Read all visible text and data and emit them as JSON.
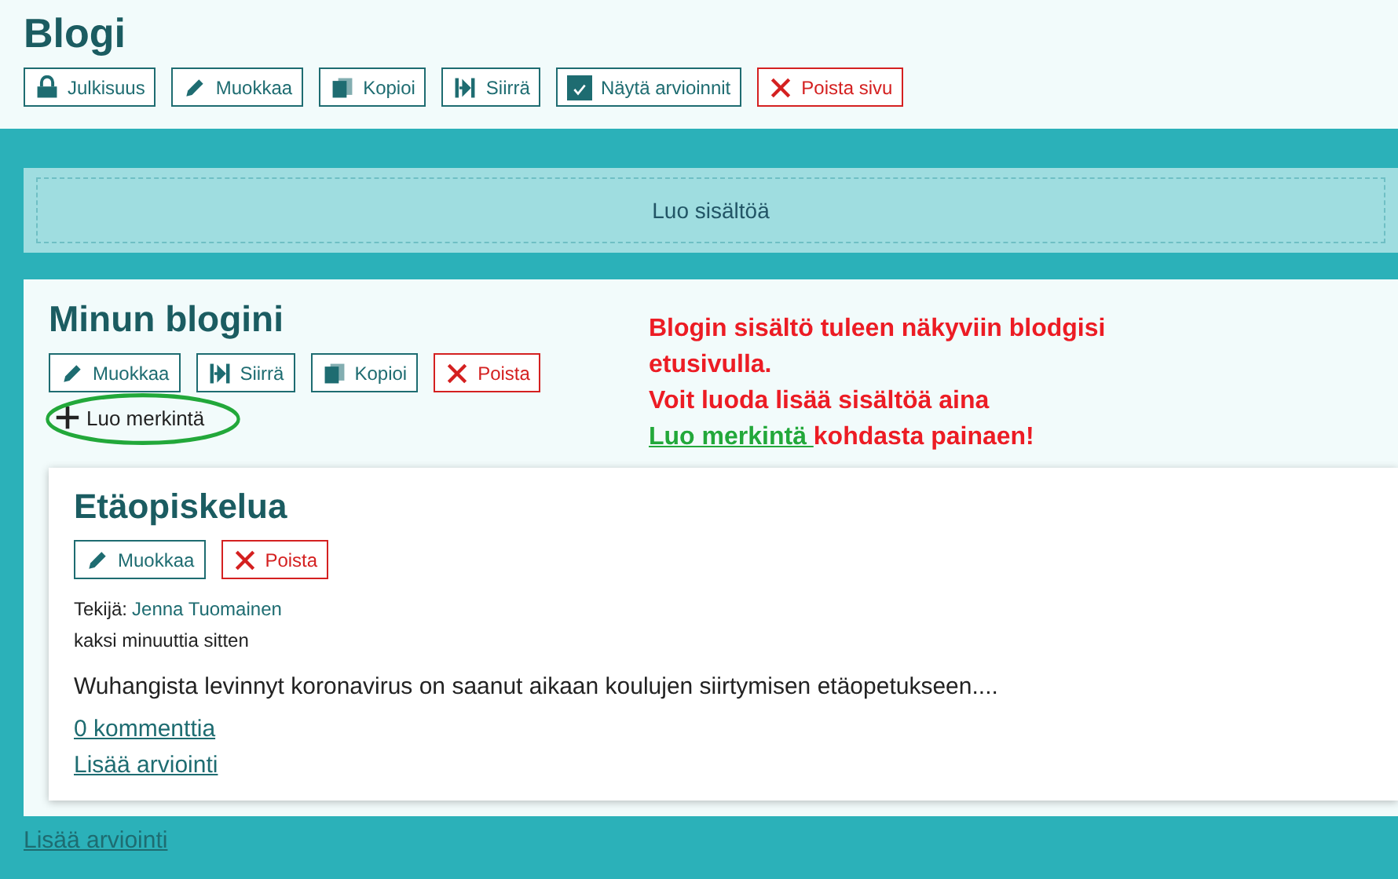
{
  "page": {
    "title": "Blogi",
    "toolbar": [
      {
        "label": "Julkisuus",
        "kind": "lock"
      },
      {
        "label": "Muokkaa",
        "kind": "pencil"
      },
      {
        "label": "Kopioi",
        "kind": "copy"
      },
      {
        "label": "Siirrä",
        "kind": "move"
      },
      {
        "label": "Näytä arvioinnit",
        "kind": "checkbox",
        "checked": true
      },
      {
        "label": "Poista sivu",
        "kind": "delete"
      }
    ]
  },
  "create_content": {
    "label": "Luo sisältöä"
  },
  "blog": {
    "title": "Minun blogini",
    "toolbar": [
      {
        "label": "Muokkaa",
        "kind": "pencil"
      },
      {
        "label": "Siirrä",
        "kind": "move"
      },
      {
        "label": "Kopioi",
        "kind": "copy"
      },
      {
        "label": "Poista",
        "kind": "delete"
      }
    ],
    "new_entry": {
      "label": "Luo merkintä"
    },
    "annotation": [
      [
        {
          "kind": "plain",
          "text": "Blogin sisältö tuleen näkyviin blodgisi etusivulla."
        }
      ],
      [
        {
          "kind": "plain",
          "text": "Voit luoda lisää sisältöä aina "
        },
        {
          "kind": "link",
          "text": "Luo merkintä "
        },
        {
          "kind": "plain",
          "text": "kohdasta painaen!"
        }
      ]
    ],
    "posts": [
      {
        "title": "Etäopiskelua",
        "toolbar": [
          {
            "label": "Muokkaa",
            "kind": "pencil"
          },
          {
            "label": "Poista",
            "kind": "delete"
          }
        ],
        "author_label": "Tekijä:",
        "author": "Jenna Tuomainen",
        "time": "kaksi minuuttia sitten",
        "excerpt": "Wuhangista levinnyt koronavirus on saanut aikaan koulujen siirtymisen etäopetukseen....",
        "comments": "0 kommenttia",
        "add_rating": "Lisää arviointi"
      }
    ]
  },
  "footer_link": "Lisää arviointi"
}
